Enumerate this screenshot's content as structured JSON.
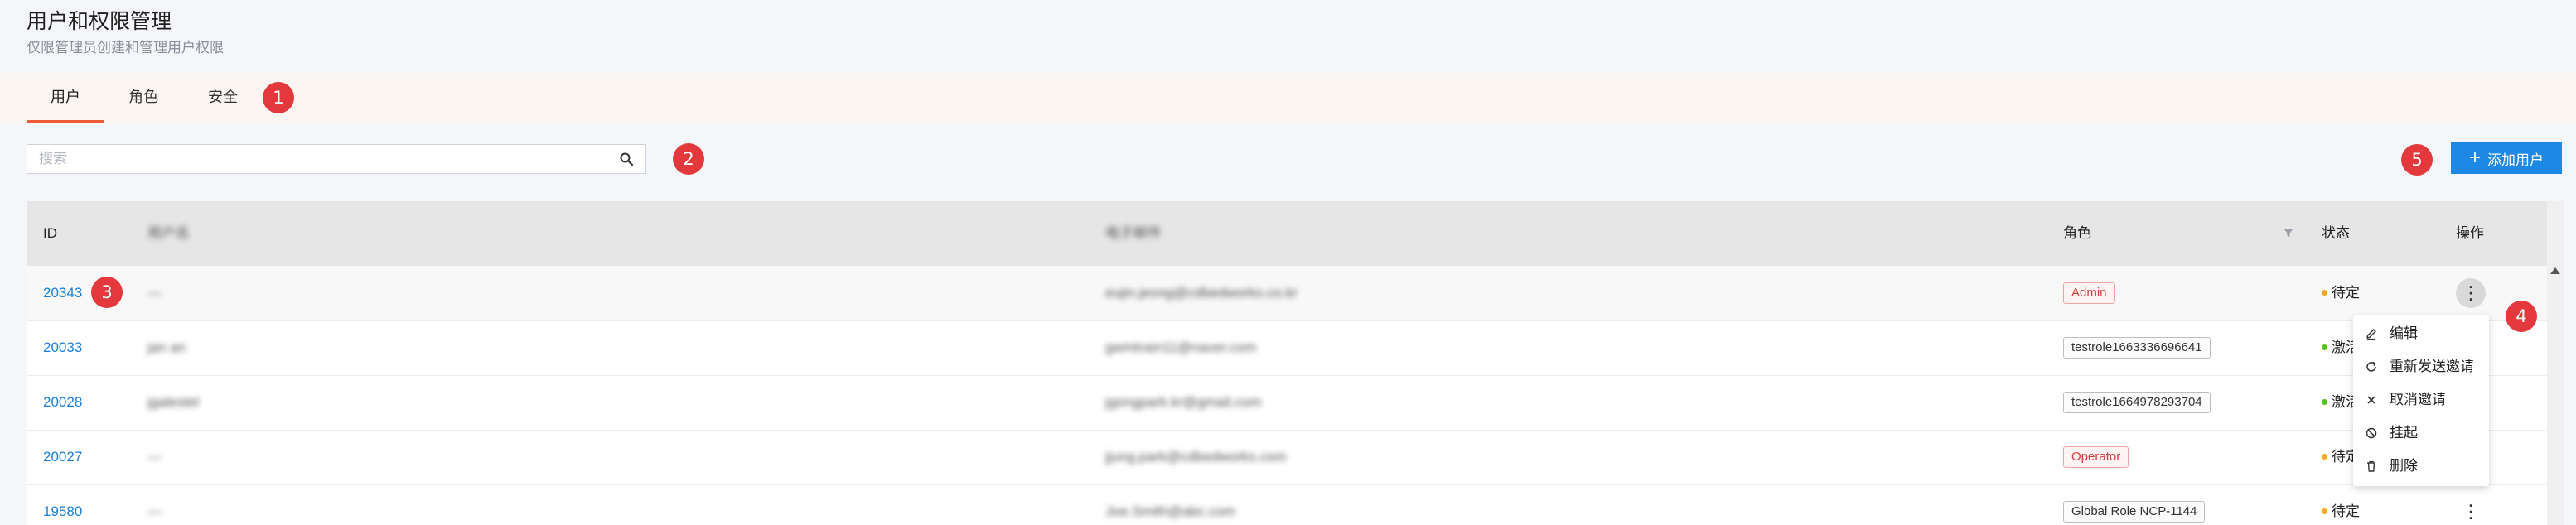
{
  "header": {
    "title": "用户和权限管理",
    "subtitle": "仅限管理员创建和管理用户权限"
  },
  "tabs": [
    {
      "label": "用户",
      "active": true
    },
    {
      "label": "角色",
      "active": false
    },
    {
      "label": "安全",
      "active": false
    }
  ],
  "search": {
    "placeholder": "搜索",
    "value": ""
  },
  "add_user_button": {
    "label": "添加用户",
    "color": "#1e88e5"
  },
  "accent_color": "#ea5b3a",
  "markers": [
    "1",
    "2",
    "3",
    "4",
    "5"
  ],
  "table": {
    "columns": {
      "id": "ID",
      "username": "用户名",
      "email": "电子邮件",
      "role": "角色",
      "status": "状态",
      "actions": "操作"
    },
    "rows": [
      {
        "id": "20343",
        "username": "—",
        "email": "eujin.jeong@cdbedworks.co.kr",
        "role": "Admin",
        "role_style": "red",
        "status": "待定",
        "status_type": "pending"
      },
      {
        "id": "20033",
        "username": "jan an",
        "email": "gwmtrain11@naver.com",
        "role": "testrole1663336696641",
        "role_style": "grey",
        "status": "激活",
        "status_type": "active"
      },
      {
        "id": "20028",
        "username": "jgalestel",
        "email": "jgongpark.kr@gmail.com",
        "role": "testrole1664978293704",
        "role_style": "grey",
        "status": "激活",
        "status_type": "active"
      },
      {
        "id": "20027",
        "username": "—",
        "email": "jjung.park@cdbedworks.com",
        "role": "Operator",
        "role_style": "red",
        "status": "待定",
        "status_type": "pending"
      },
      {
        "id": "19580",
        "username": "—",
        "email": "Joe.Smith@abc.com",
        "role": "Global Role NCP-1144",
        "role_style": "grey",
        "status": "待定",
        "status_type": "pending"
      }
    ]
  },
  "action_menu": {
    "items": [
      {
        "label": "编辑",
        "icon": "pencil-icon"
      },
      {
        "label": "重新发送邀请",
        "icon": "refresh-icon"
      },
      {
        "label": "取消邀请",
        "icon": "close-icon"
      },
      {
        "label": "挂起",
        "icon": "ban-icon"
      },
      {
        "label": "删除",
        "icon": "trash-icon"
      }
    ]
  }
}
